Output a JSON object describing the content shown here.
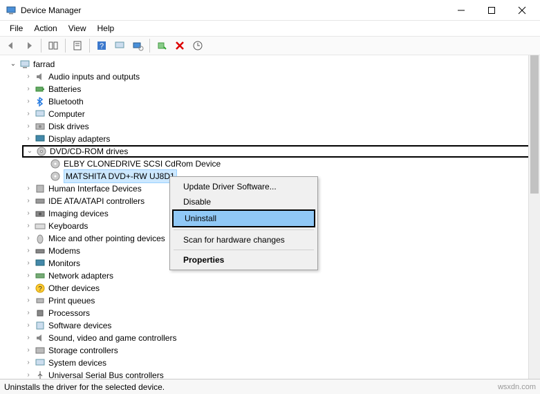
{
  "window": {
    "title": "Device Manager"
  },
  "menu": {
    "file": "File",
    "action": "Action",
    "view": "View",
    "help": "Help"
  },
  "tree": {
    "root": "farrad",
    "items": [
      "Audio inputs and outputs",
      "Batteries",
      "Bluetooth",
      "Computer",
      "Disk drives",
      "Display adapters"
    ],
    "dvd": {
      "label": "DVD/CD-ROM drives",
      "children": [
        "ELBY CLONEDRIVE SCSI CdRom Device",
        "MATSHITA DVD+-RW UJ8D1"
      ]
    },
    "rest": [
      "Human Interface Devices",
      "IDE ATA/ATAPI controllers",
      "Imaging devices",
      "Keyboards",
      "Mice and other pointing devices",
      "Modems",
      "Monitors",
      "Network adapters",
      "Other devices",
      "Print queues",
      "Processors",
      "Software devices",
      "Sound, video and game controllers",
      "Storage controllers",
      "System devices",
      "Universal Serial Bus controllers"
    ]
  },
  "context_menu": {
    "update": "Update Driver Software...",
    "disable": "Disable",
    "uninstall": "Uninstall",
    "scan": "Scan for hardware changes",
    "properties": "Properties"
  },
  "status": "Uninstalls the driver for the selected device.",
  "watermark": "wsxdn.com"
}
